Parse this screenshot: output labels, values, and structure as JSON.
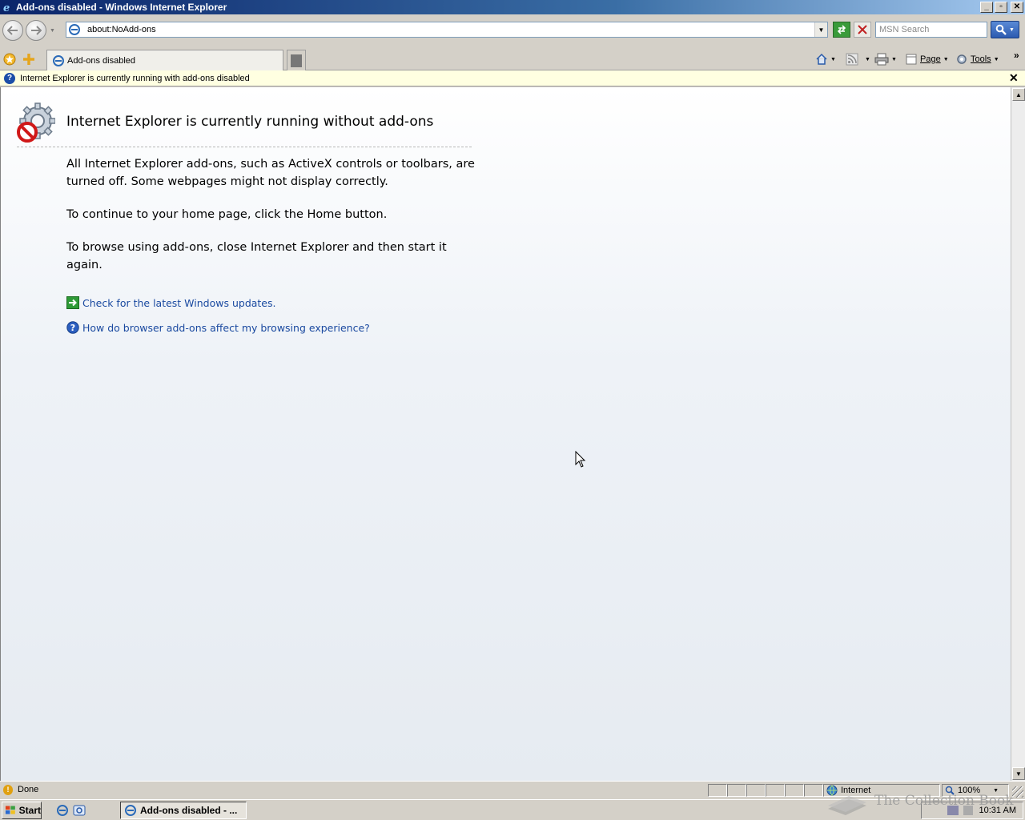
{
  "window": {
    "title": "Add-ons disabled - Windows Internet Explorer",
    "controls": {
      "minimize": "_",
      "maximize": "▫",
      "close": "✕"
    }
  },
  "navbar": {
    "address": "about:NoAdd-ons",
    "search_placeholder": "MSN Search"
  },
  "tabs": [
    {
      "label": "Add-ons disabled",
      "icon": "ie-page-icon"
    }
  ],
  "command_bar": {
    "page_label": "Page",
    "tools_label": "Tools",
    "overflow": "»"
  },
  "infobar": {
    "text": "Internet Explorer is currently running with add-ons disabled",
    "close": "✕"
  },
  "page": {
    "heading": "Internet Explorer is currently running without add-ons",
    "paragraphs": [
      "All Internet Explorer add-ons, such as ActiveX controls or toolbars, are turned off. Some webpages might not display correctly.",
      "To continue to your home page, click the Home button.",
      "To browse using add-ons, close Internet Explorer and then start it again."
    ],
    "links": [
      {
        "label": "Check for the latest Windows updates.",
        "icon": "green-arrow-icon"
      },
      {
        "label": "How do browser add-ons affect my browsing experience?",
        "icon": "help-icon"
      }
    ]
  },
  "statusbar": {
    "status": "Done",
    "zone": "Internet",
    "zoom": "100%"
  },
  "taskbar": {
    "start_label": "Start",
    "task_label": "Add-ons disabled - ...",
    "clock": "10:31 AM"
  },
  "watermark": "The Collection Book",
  "colors": {
    "title_gradient_start": "#0a246a",
    "title_gradient_end": "#a6caf0",
    "link": "#1b4aa0",
    "infobar_bg": "#ffffe1",
    "chrome": "#d4d0c8"
  }
}
